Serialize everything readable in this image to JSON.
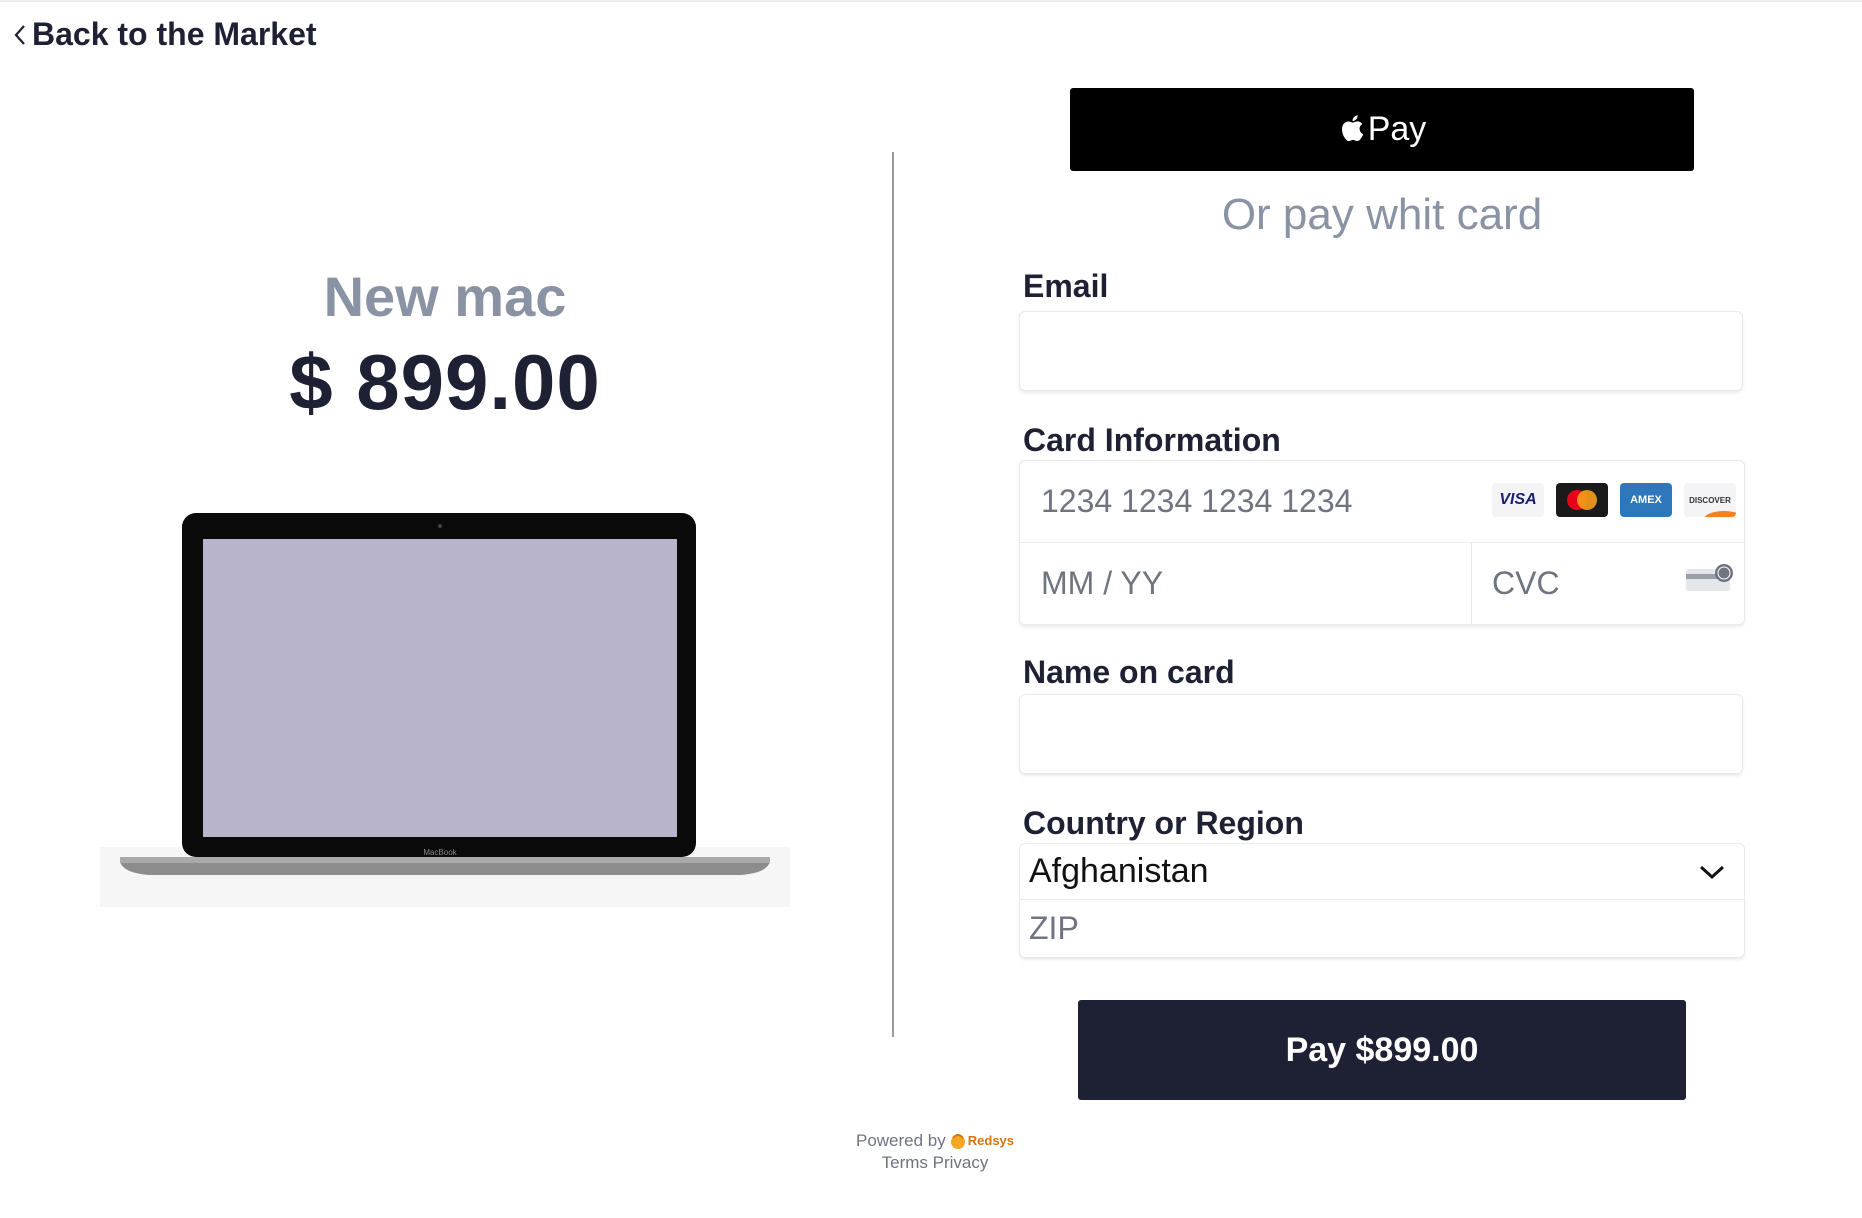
{
  "nav": {
    "back_label": "Back to the Market"
  },
  "product": {
    "name": "New mac",
    "price": "$ 899.00",
    "laptop_brand": "MacBook"
  },
  "wallet": {
    "apple_pay_label": "Pay",
    "alt_text": "Or pay whit card"
  },
  "form": {
    "email_label": "Email",
    "email_value": "",
    "card_label": "Card Information",
    "card_number_placeholder": "1234 1234 1234 1234",
    "expiry_placeholder": "MM / YY",
    "cvc_placeholder": "CVC",
    "card_brands": [
      "VISA",
      "MasterCard",
      "AMEX",
      "DISCOVER"
    ],
    "name_label": "Name on card",
    "name_value": "",
    "country_label": "Country or Region",
    "country_selected": "Afghanistan",
    "zip_placeholder": "ZIP",
    "pay_label": "Pay $899.00"
  },
  "footer": {
    "powered_by": "Powered by",
    "provider": "Redsys",
    "terms": "Terms",
    "privacy": "Privacy"
  },
  "colors": {
    "primary": "#1e2033",
    "muted": "#8a93a3",
    "apple_pay_bg": "#000000"
  }
}
